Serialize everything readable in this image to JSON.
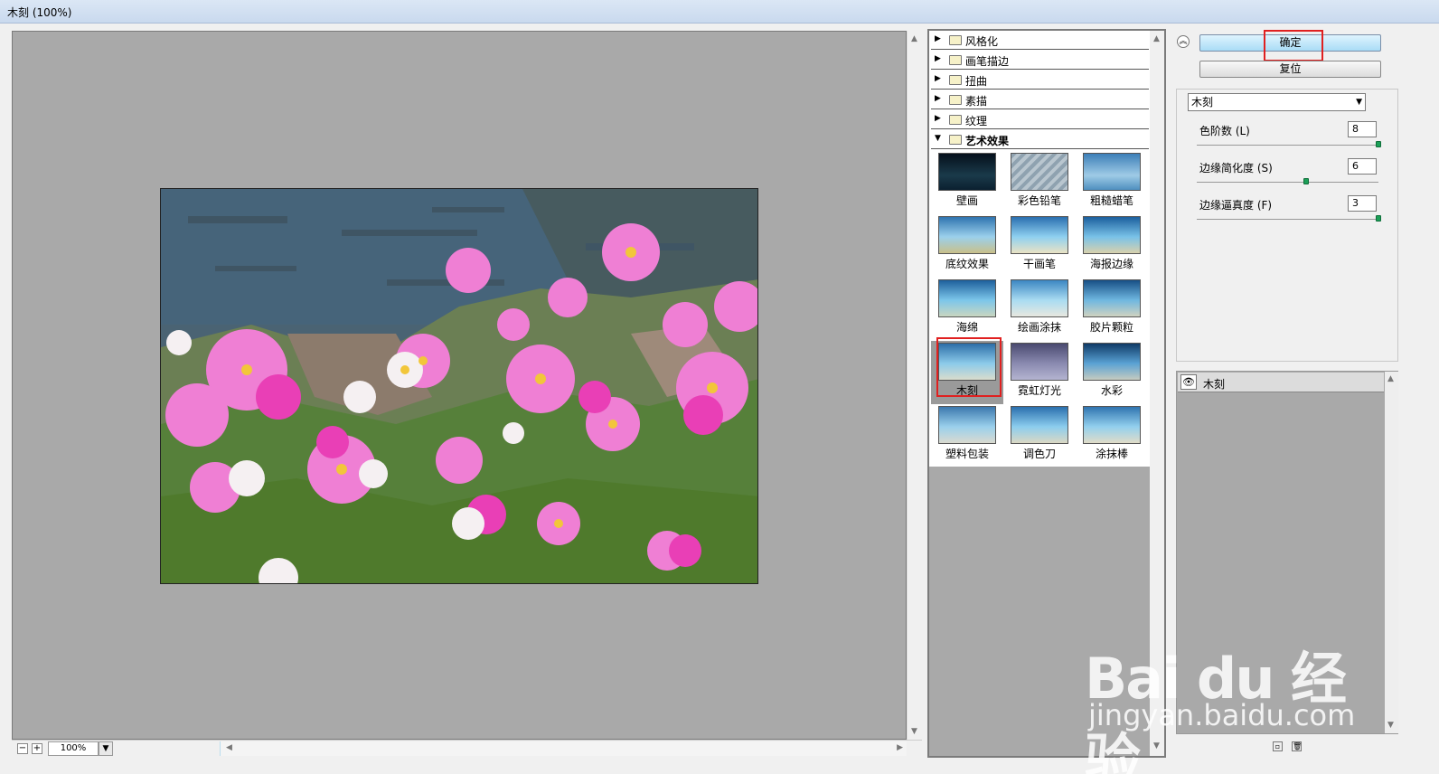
{
  "window": {
    "title": "木刻 (100%)"
  },
  "preview": {
    "zoom": "100%"
  },
  "gallery": {
    "folders": [
      {
        "label": "风格化",
        "expanded": false
      },
      {
        "label": "画笔描边",
        "expanded": false
      },
      {
        "label": "扭曲",
        "expanded": false
      },
      {
        "label": "素描",
        "expanded": false
      },
      {
        "label": "纹理",
        "expanded": false
      },
      {
        "label": "艺术效果",
        "expanded": true
      }
    ],
    "filters": [
      "壁画",
      "彩色铅笔",
      "粗糙蜡笔",
      "底纹效果",
      "干画笔",
      "海报边缘",
      "海绵",
      "绘画涂抹",
      "胶片颗粒",
      "木刻",
      "霓虹灯光",
      "水彩",
      "塑料包装",
      "调色刀",
      "涂抹棒"
    ],
    "selected_filter": "木刻"
  },
  "buttons": {
    "ok": "确定",
    "reset": "复位"
  },
  "settings": {
    "filter_select": "木刻",
    "params": [
      {
        "label": "色阶数 (L)",
        "value": "8",
        "fraction": 1.0
      },
      {
        "label": "边缘简化度 (S)",
        "value": "6",
        "fraction": 0.6
      },
      {
        "label": "边缘逼真度 (F)",
        "value": "3",
        "fraction": 1.0
      }
    ]
  },
  "layers": {
    "items": [
      {
        "name": "木刻"
      }
    ]
  },
  "watermark": {
    "main": "Bai du 经验",
    "sub": "jingyan.baidu.com"
  },
  "colors": {
    "accent_red": "#e02020",
    "preview_bg": "#a9a9a9",
    "ok_button": "#a9dcf6"
  }
}
